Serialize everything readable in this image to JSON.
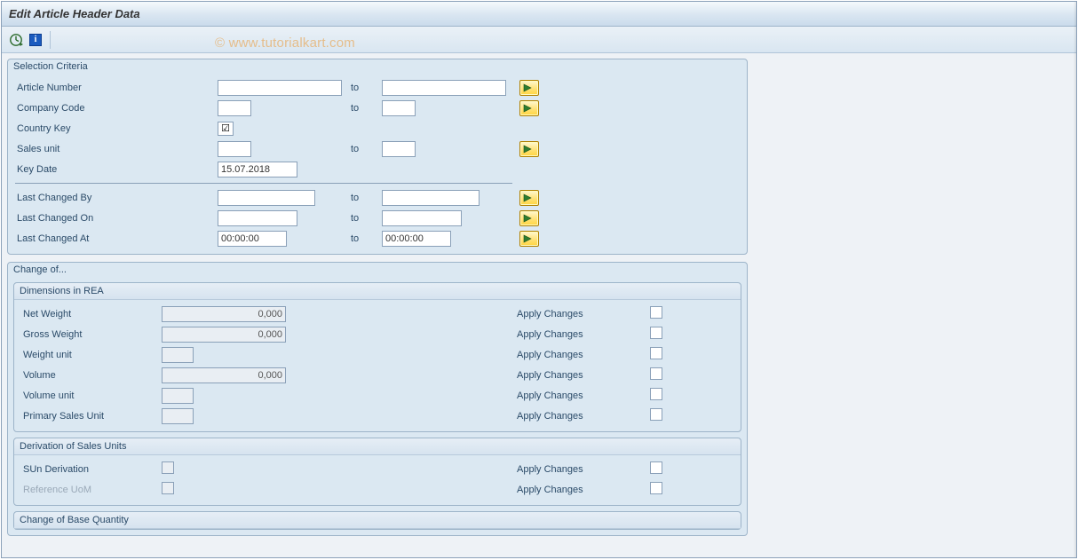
{
  "title": "Edit Article Header Data",
  "watermark": "© www.tutorialkart.com",
  "selectionCriteria": {
    "title": "Selection Criteria",
    "toLabel": "to",
    "rows": {
      "articleNumber": {
        "label": "Article Number",
        "from": "",
        "to": ""
      },
      "companyCode": {
        "label": "Company Code",
        "from": "",
        "to": ""
      },
      "countryKey": {
        "label": "Country Key",
        "checkMark": "☑"
      },
      "salesUnit": {
        "label": "Sales unit",
        "from": "",
        "to": ""
      },
      "keyDate": {
        "label": "Key Date",
        "value": "15.07.2018"
      },
      "lastChangedBy": {
        "label": "Last Changed By",
        "from": "",
        "to": ""
      },
      "lastChangedOn": {
        "label": "Last Changed On",
        "from": "",
        "to": ""
      },
      "lastChangedAt": {
        "label": "Last Changed At",
        "from": "00:00:00",
        "to": "00:00:00"
      }
    }
  },
  "changeOf": {
    "title": "Change of...",
    "dimensions": {
      "title": "Dimensions in REA",
      "applyLabel": "Apply Changes",
      "rows": {
        "netWeight": {
          "label": "Net Weight",
          "value": "0,000"
        },
        "grossWeight": {
          "label": "Gross Weight",
          "value": "0,000"
        },
        "weightUnit": {
          "label": "Weight unit",
          "value": ""
        },
        "volume": {
          "label": "Volume",
          "value": "0,000"
        },
        "volumeUnit": {
          "label": "Volume unit",
          "value": ""
        },
        "primarySalesUnit": {
          "label": "Primary Sales Unit",
          "value": ""
        }
      }
    },
    "derivation": {
      "title": "Derivation of Sales Units",
      "applyLabel": "Apply Changes",
      "rows": {
        "sunDerivation": {
          "label": "SUn Derivation"
        },
        "referenceUom": {
          "label": "Reference UoM"
        }
      }
    },
    "baseQty": {
      "title": "Change of Base Quantity"
    }
  }
}
